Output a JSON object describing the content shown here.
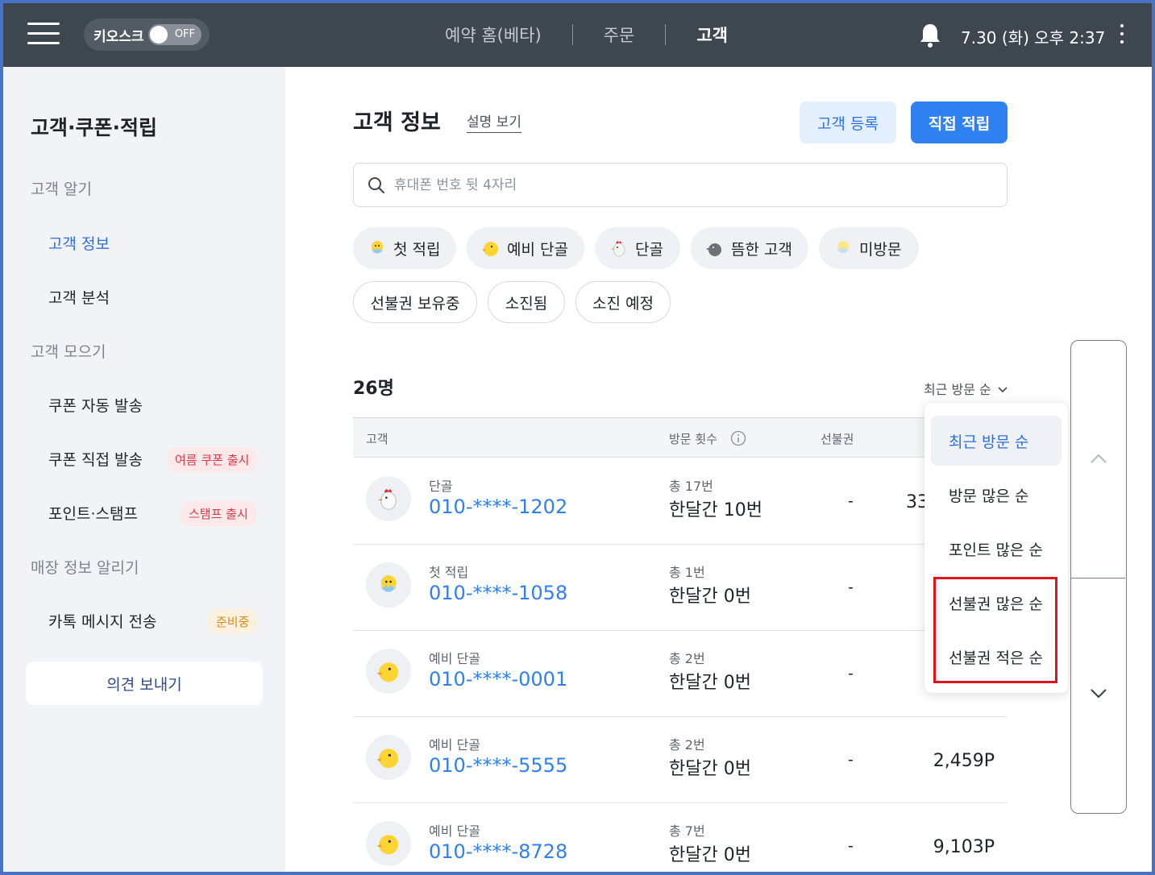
{
  "topbar": {
    "kiosk_label": "키오스크",
    "kiosk_state": "OFF",
    "nav": [
      "예약 홈(베타)",
      "주문",
      "고객"
    ],
    "active_nav": "고객",
    "datetime": "7.30 (화) 오후 2:37"
  },
  "sidebar": {
    "title": "고객·쿠폰·적립",
    "sections": {
      "know": "고객 알기",
      "gather": "고객 모으기",
      "notify": "매장 정보 알리기"
    },
    "items": {
      "info": "고객 정보",
      "analysis": "고객 분석",
      "coupon_auto": "쿠폰 자동 발송",
      "coupon_direct": "쿠폰 직접 발송",
      "points": "포인트·스탬프",
      "kakao": "카톡 메시지 전송"
    },
    "badges": {
      "coupon_direct": "여름 쿠폰 출시",
      "points": "스탬프 출시",
      "kakao": "준비중"
    },
    "feedback": "의견 보내기"
  },
  "main": {
    "title": "고객 정보",
    "help_link": "설명 보기",
    "register_button": "고객 등록",
    "earn_button": "직접 적립",
    "search_placeholder": "휴대폰 번호 뒷 4자리",
    "grade_chips": [
      "첫 적립",
      "예비 단골",
      "단골",
      "뜸한 고객",
      "미방문"
    ],
    "prepaid_chips": [
      "선불권 보유중",
      "소진됨",
      "소진 예정"
    ],
    "count": "26명",
    "sort_label": "최근 방문 순",
    "columns": {
      "customer": "고객",
      "visits": "방문 횟수",
      "prepaid": "선불권"
    },
    "rows": [
      {
        "grade": "단골",
        "phone": "010-****-1202",
        "total": "총 17번",
        "month": "한달간 10번",
        "prepaid": "-",
        "points": "33"
      },
      {
        "grade": "첫 적립",
        "phone": "010-****-1058",
        "total": "총 1번",
        "month": "한달간 0번",
        "prepaid": "-",
        "points": ""
      },
      {
        "grade": "예비 단골",
        "phone": "010-****-0001",
        "total": "총 2번",
        "month": "한달간 0번",
        "prepaid": "-",
        "points": ""
      },
      {
        "grade": "예비 단골",
        "phone": "010-****-5555",
        "total": "총 2번",
        "month": "한달간 0번",
        "prepaid": "-",
        "points": "2,459P"
      },
      {
        "grade": "예비 단골",
        "phone": "010-****-8728",
        "total": "총 7번",
        "month": "한달간 0번",
        "prepaid": "-",
        "points": "9,103P"
      }
    ]
  },
  "sort_dropdown": {
    "options": [
      "최근 방문 순",
      "방문 많은 순",
      "포인트 많은 순",
      "선불권 많은 순",
      "선불권 적은 순"
    ],
    "selected": "최근 방문 순"
  },
  "colors": {
    "topbar": "#3e4650",
    "accent": "#2f80f0",
    "highlight": "#e0141b"
  }
}
